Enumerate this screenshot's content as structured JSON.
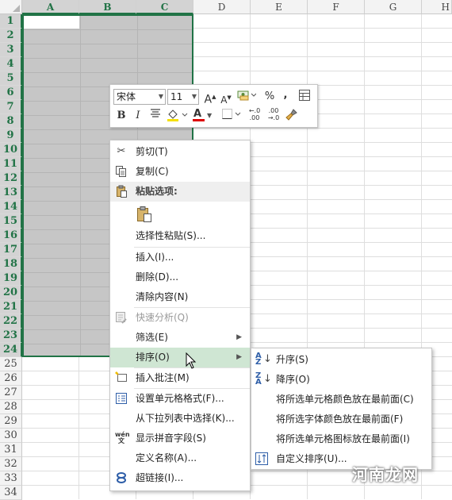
{
  "columns": [
    "A",
    "B",
    "C",
    "D",
    "E",
    "F",
    "G",
    "H"
  ],
  "selected_columns": [
    "A",
    "B",
    "C"
  ],
  "rows": [
    "1",
    "2",
    "3",
    "4",
    "5",
    "6",
    "7",
    "8",
    "9",
    "10",
    "11",
    "12",
    "13",
    "14",
    "15",
    "16",
    "17",
    "18",
    "19",
    "20",
    "21",
    "22",
    "23",
    "24",
    "25",
    "26",
    "27",
    "28",
    "29",
    "30",
    "31",
    "32",
    "33",
    "34"
  ],
  "selected_row_count": 24,
  "colors": {
    "accent": "#217346",
    "selection": "#c6c6c6",
    "menu_highlight": "#cfe6d3"
  },
  "mini_toolbar": {
    "font_name": "宋体",
    "font_size": "11",
    "increase_font_icon": "A",
    "decrease_font_icon": "A",
    "percent_label": "%",
    "comma_label": ",",
    "bold_label": "B",
    "italic_label": "I",
    "font_color_label": "A",
    "decimal_increase_label": "←.0\n.00",
    "decimal_decrease_label": ".00\n→.0"
  },
  "context_menu": {
    "items": [
      {
        "label": "剪切(T)",
        "icon": "scissors-icon"
      },
      {
        "label": "复制(C)",
        "icon": "copy-icon"
      },
      {
        "label": "粘贴选项:",
        "icon": "paste-icon",
        "header": true
      },
      {
        "label": "",
        "icon": "paste-clipboard-icon"
      },
      {
        "label": "选择性粘贴(S)...",
        "icon": ""
      },
      {
        "label": "插入(I)...",
        "icon": ""
      },
      {
        "label": "删除(D)...",
        "icon": ""
      },
      {
        "label": "清除内容(N)",
        "icon": ""
      },
      {
        "label": "快速分析(Q)",
        "icon": "quick-analysis-icon",
        "disabled": true
      },
      {
        "label": "筛选(E)",
        "icon": "",
        "submenu": true
      },
      {
        "label": "排序(O)",
        "icon": "",
        "submenu": true,
        "highlighted": true
      },
      {
        "label": "插入批注(M)",
        "icon": "comment-icon"
      },
      {
        "label": "设置单元格格式(F)...",
        "icon": "format-cells-icon"
      },
      {
        "label": "从下拉列表中选择(K)...",
        "icon": ""
      },
      {
        "label": "显示拼音字段(S)",
        "icon": "phonetic-icon"
      },
      {
        "label": "定义名称(A)...",
        "icon": ""
      },
      {
        "label": "超链接(I)...",
        "icon": "hyperlink-icon"
      }
    ]
  },
  "sort_submenu": {
    "items": [
      {
        "label": "升序(S)",
        "icon": "sort-ascending-icon"
      },
      {
        "label": "降序(O)",
        "icon": "sort-descending-icon"
      },
      {
        "label": "将所选单元格颜色放在最前面(C)",
        "icon": ""
      },
      {
        "label": "将所选字体颜色放在最前面(F)",
        "icon": ""
      },
      {
        "label": "将所选单元格图标放在最前面(I)",
        "icon": ""
      },
      {
        "label": "自定义排序(U)...",
        "icon": "custom-sort-icon"
      }
    ]
  },
  "watermark": "河南龙网"
}
